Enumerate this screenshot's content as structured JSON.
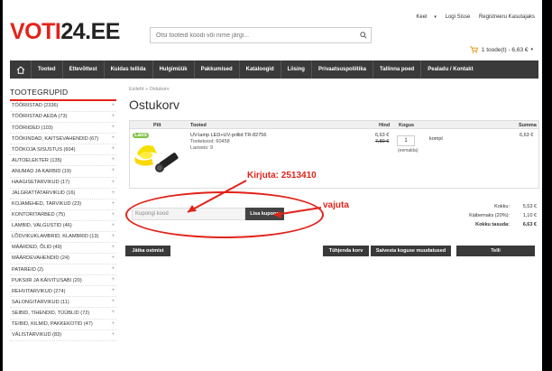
{
  "header": {
    "logo_prefix": "VOTI",
    "logo_suffix": "24.EE",
    "search_placeholder": "Otsi tooteid koodi või nime järgi...",
    "top_links": [
      "Keel",
      "Logi Sisse",
      "Registreeru Kasutajaks"
    ],
    "cart_summary": "1 toode(t) - 6,63 €"
  },
  "nav": {
    "items": [
      "Tooted",
      "Ettevõttest",
      "Kuidas tellida",
      "Hulgimüük",
      "Pakkumised",
      "Kataloogid",
      "Liising",
      "Privaatsuspoliitika",
      "Tallinna poed",
      "Pealadu / Kontakt"
    ]
  },
  "sidebar": {
    "title": "TOOTEGRUPID",
    "categories": [
      "TÖÖRIISTAD (2336)",
      "TÖÖRIISTAD AEDA (73)",
      "TÖÖRIIDED (103)",
      "TÖÖKINDAD, KAITSEVAHENDID (67)",
      "TÖÖKOJA SISUSTUS (604)",
      "AUTOELEKTER (135)",
      "ANUMAD JA KARBID (19)",
      "HAAGISETARVIKUD (17)",
      "JALGRATTATARVIKUD (16)",
      "KOJAMEHED, TARVIKUD (23)",
      "KONTORITARBED (75)",
      "LAMBID, VALGUSTID (46)",
      "LÕDVIKUKLAMBRID, KLAMBRID (13)",
      "MÄÄRDED, ÕLID (49)",
      "MÄÄRDEVAHENDID (24)",
      "PATAREID (2)",
      "PUKSIIR JA KÄIVITUSABI (20)",
      "REHVITARVIKUD (274)",
      "SALONGITARVIKUD (11)",
      "SEIBID, TIHENDID, TÜÜBLID (72)",
      "TEIBID, KILMID, PAKKEKOTID (47)",
      "VÄLISTARVIKUD (83)"
    ]
  },
  "main": {
    "breadcrumb": "Esileht  »  Ostukorv",
    "title": "Ostukorv",
    "columns": {
      "image": "Pilt",
      "product": "Tooted",
      "price": "Hind",
      "quantity": "Kogus",
      "total": "Summa"
    },
    "product": {
      "badge": "Laos",
      "name": "UV-lamp LED+UV-prillid TR-82756",
      "code": "Tootekood: 60458",
      "stock": "Laoseis: 9",
      "price_new": "6,63 €",
      "price_old": "7,80 €",
      "quantity": "1",
      "unit": "kompl",
      "remove": "(eemalda)",
      "total": "6,63 €"
    },
    "coupon": {
      "placeholder": "Kupongi kood",
      "button": "Lisa kupong"
    },
    "annotations": {
      "write": "Kirjuta: 2513410",
      "press": "vajuta"
    },
    "totals": [
      {
        "label": "Kokku:",
        "value": "5,53 €"
      },
      {
        "label": "Käibemaks (20%):",
        "value": "1,10 €"
      },
      {
        "label": "Kokku tasuda:",
        "value": "6,63 €"
      }
    ],
    "buttons": {
      "continue": "Jätka ostmist",
      "empty": "Tühjenda korv",
      "save": "Salvesta koguse muudatused",
      "order": "Telli"
    }
  },
  "colors": {
    "accent": "#e2231a",
    "nav": "#3a3a3a"
  }
}
